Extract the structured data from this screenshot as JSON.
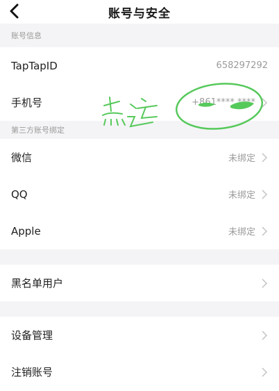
{
  "nav": {
    "title": "账号与安全"
  },
  "sections": {
    "account_info": "账号信息",
    "third_party": "第三方账号绑定"
  },
  "rows": {
    "taptapid": {
      "label": "TapTapID",
      "value": "658297292"
    },
    "phone": {
      "label": "手机号",
      "value": "+861**** ****"
    },
    "wechat": {
      "label": "微信",
      "value": "未绑定"
    },
    "qq": {
      "label": "QQ",
      "value": "未绑定"
    },
    "apple": {
      "label": "Apple",
      "value": "未绑定"
    },
    "blacklist": {
      "label": "黑名单用户"
    },
    "devices": {
      "label": "设备管理"
    },
    "deactivate": {
      "label": "注销账号"
    }
  },
  "annotation": {
    "handwriting": "点这"
  },
  "colors": {
    "annotation": "#56c95b",
    "muted": "#9b9b9b",
    "section_bg": "#f4f4f6"
  }
}
